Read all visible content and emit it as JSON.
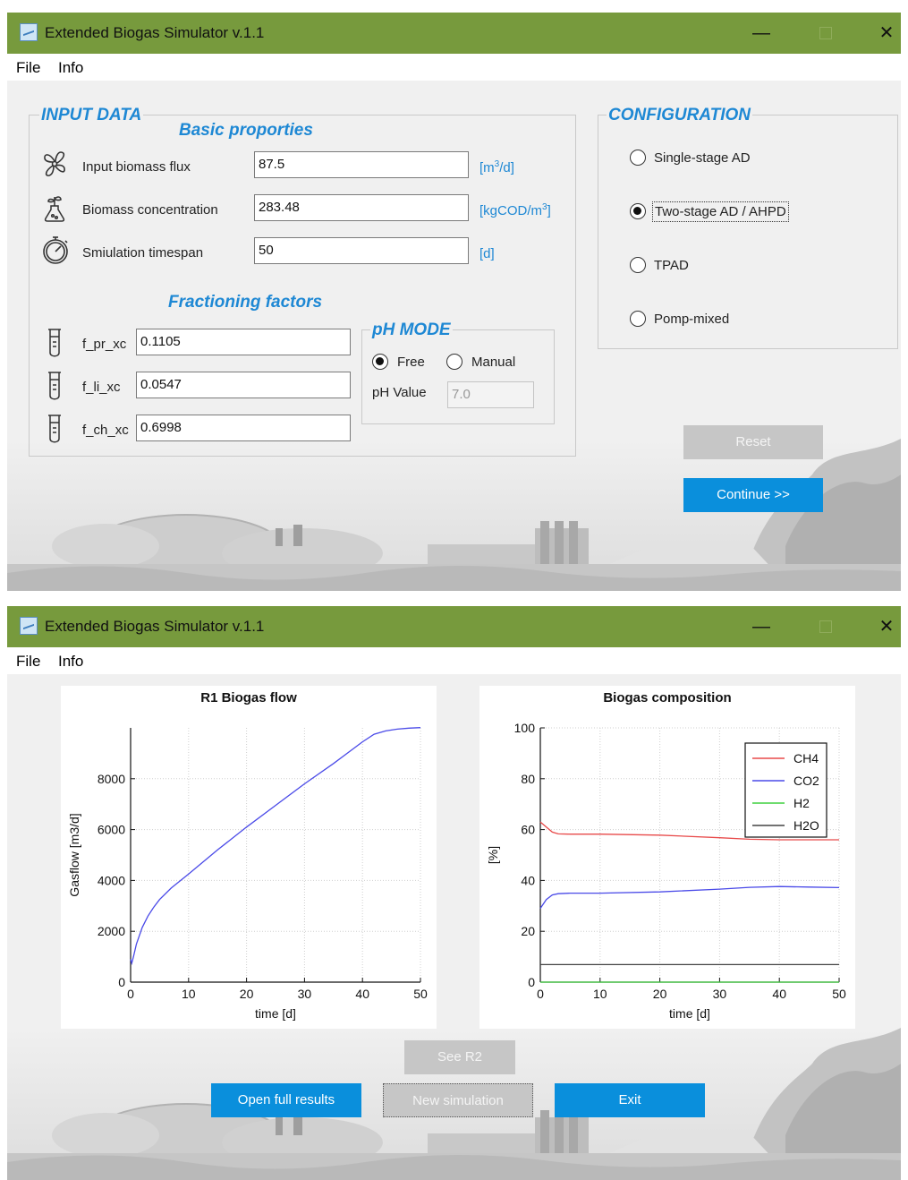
{
  "app": {
    "title": "Extended Biogas Simulator v.1.1",
    "menu": [
      "File",
      "Info"
    ],
    "min_glyph": "—",
    "close_glyph": "✕"
  },
  "input": {
    "section_title": "INPUT DATA",
    "basic_title": "Basic proporties",
    "rows": [
      {
        "label": "Input biomass flux",
        "value": "87.5",
        "unit_pre": "[m",
        "unit_sup": "3",
        "unit_post": "/d]",
        "icon": "fan-icon"
      },
      {
        "label": "Biomass concentration",
        "value": "283.48",
        "unit_pre": "[kgCOD/m",
        "unit_sup": "3",
        "unit_post": "]",
        "icon": "plant-flask-icon"
      },
      {
        "label": "Smiulation timespan",
        "value": "50",
        "unit_pre": "[d]",
        "unit_sup": "",
        "unit_post": "",
        "icon": "stopwatch-icon"
      }
    ],
    "fractioning_title": "Fractioning factors",
    "factors": [
      {
        "label": "f_pr_xc",
        "value": "0.1105",
        "icon": "test-tube-icon"
      },
      {
        "label": "f_li_xc",
        "value": "0.0547",
        "icon": "test-tube-icon"
      },
      {
        "label": "f_ch_xc",
        "value": "0.6998",
        "icon": "test-tube-icon"
      }
    ],
    "ph": {
      "title": "pH MODE",
      "options": [
        "Free",
        "Manual"
      ],
      "selected": "Free",
      "value_label": "pH Value",
      "value": "7.0"
    }
  },
  "configuration": {
    "title": "CONFIGURATION",
    "options": [
      "Single-stage AD",
      "Two-stage AD / AHPD",
      "TPAD",
      "Pomp-mixed"
    ],
    "selected": "Two-stage AD / AHPD"
  },
  "buttons1": {
    "reset": "Reset",
    "continue": "Continue >>"
  },
  "buttons2": {
    "see_r2": "See R2",
    "open_full": "Open full results",
    "new_sim": "New simulation",
    "exit": "Exit"
  },
  "colors": {
    "titlebar": "#779a3d",
    "accent": "#1e88d4",
    "button_blue": "#0a8fdc",
    "button_disabled": "#c6c6c6"
  },
  "chart_data": [
    {
      "type": "line",
      "title": "R1 Biogas flow",
      "xlabel": "time [d]",
      "ylabel": "Gasflow [m3/d]",
      "xlim": [
        0,
        50
      ],
      "ylim": [
        0,
        10000
      ],
      "xticks": [
        0,
        10,
        20,
        30,
        40,
        50
      ],
      "yticks": [
        0,
        2000,
        4000,
        6000,
        8000
      ],
      "grid": true,
      "series": [
        {
          "color": "#4a4ae8",
          "x": [
            0,
            0.2,
            0.5,
            1,
            2,
            3,
            4,
            5,
            7,
            10,
            15,
            20,
            25,
            30,
            35,
            40,
            42,
            44,
            46,
            48,
            50
          ],
          "y": [
            900,
            750,
            1000,
            1500,
            2150,
            2600,
            2950,
            3250,
            3700,
            4250,
            5200,
            6100,
            6950,
            7800,
            8600,
            9450,
            9750,
            9880,
            9950,
            9990,
            10010
          ]
        }
      ]
    },
    {
      "type": "line",
      "title": "Biogas composition",
      "xlabel": "time [d]",
      "ylabel": "[%]",
      "xlim": [
        0,
        50
      ],
      "ylim": [
        0,
        100
      ],
      "xticks": [
        0,
        10,
        20,
        30,
        40,
        50
      ],
      "yticks": [
        0,
        20,
        40,
        60,
        80,
        100
      ],
      "grid": true,
      "legend": "top-right",
      "series": [
        {
          "name": "CH4",
          "color": "#e84a4a",
          "x": [
            0,
            1,
            2,
            3,
            5,
            10,
            20,
            30,
            35,
            40,
            45,
            50
          ],
          "y": [
            63,
            61,
            59,
            58.3,
            58.2,
            58.2,
            57.8,
            56.8,
            56.2,
            56,
            56,
            56
          ]
        },
        {
          "name": "CO2",
          "color": "#4a4ae8",
          "x": [
            0,
            1,
            2,
            3,
            5,
            10,
            20,
            30,
            35,
            40,
            45,
            50
          ],
          "y": [
            29,
            32.5,
            34.3,
            34.8,
            35,
            35,
            35.5,
            36.6,
            37.3,
            37.6,
            37.4,
            37.2
          ]
        },
        {
          "name": "H2",
          "color": "#3fd03f",
          "x": [
            0,
            50
          ],
          "y": [
            0,
            0
          ]
        },
        {
          "name": "H2O",
          "color": "#444444",
          "x": [
            0,
            50
          ],
          "y": [
            6.9,
            6.9
          ]
        }
      ]
    }
  ]
}
